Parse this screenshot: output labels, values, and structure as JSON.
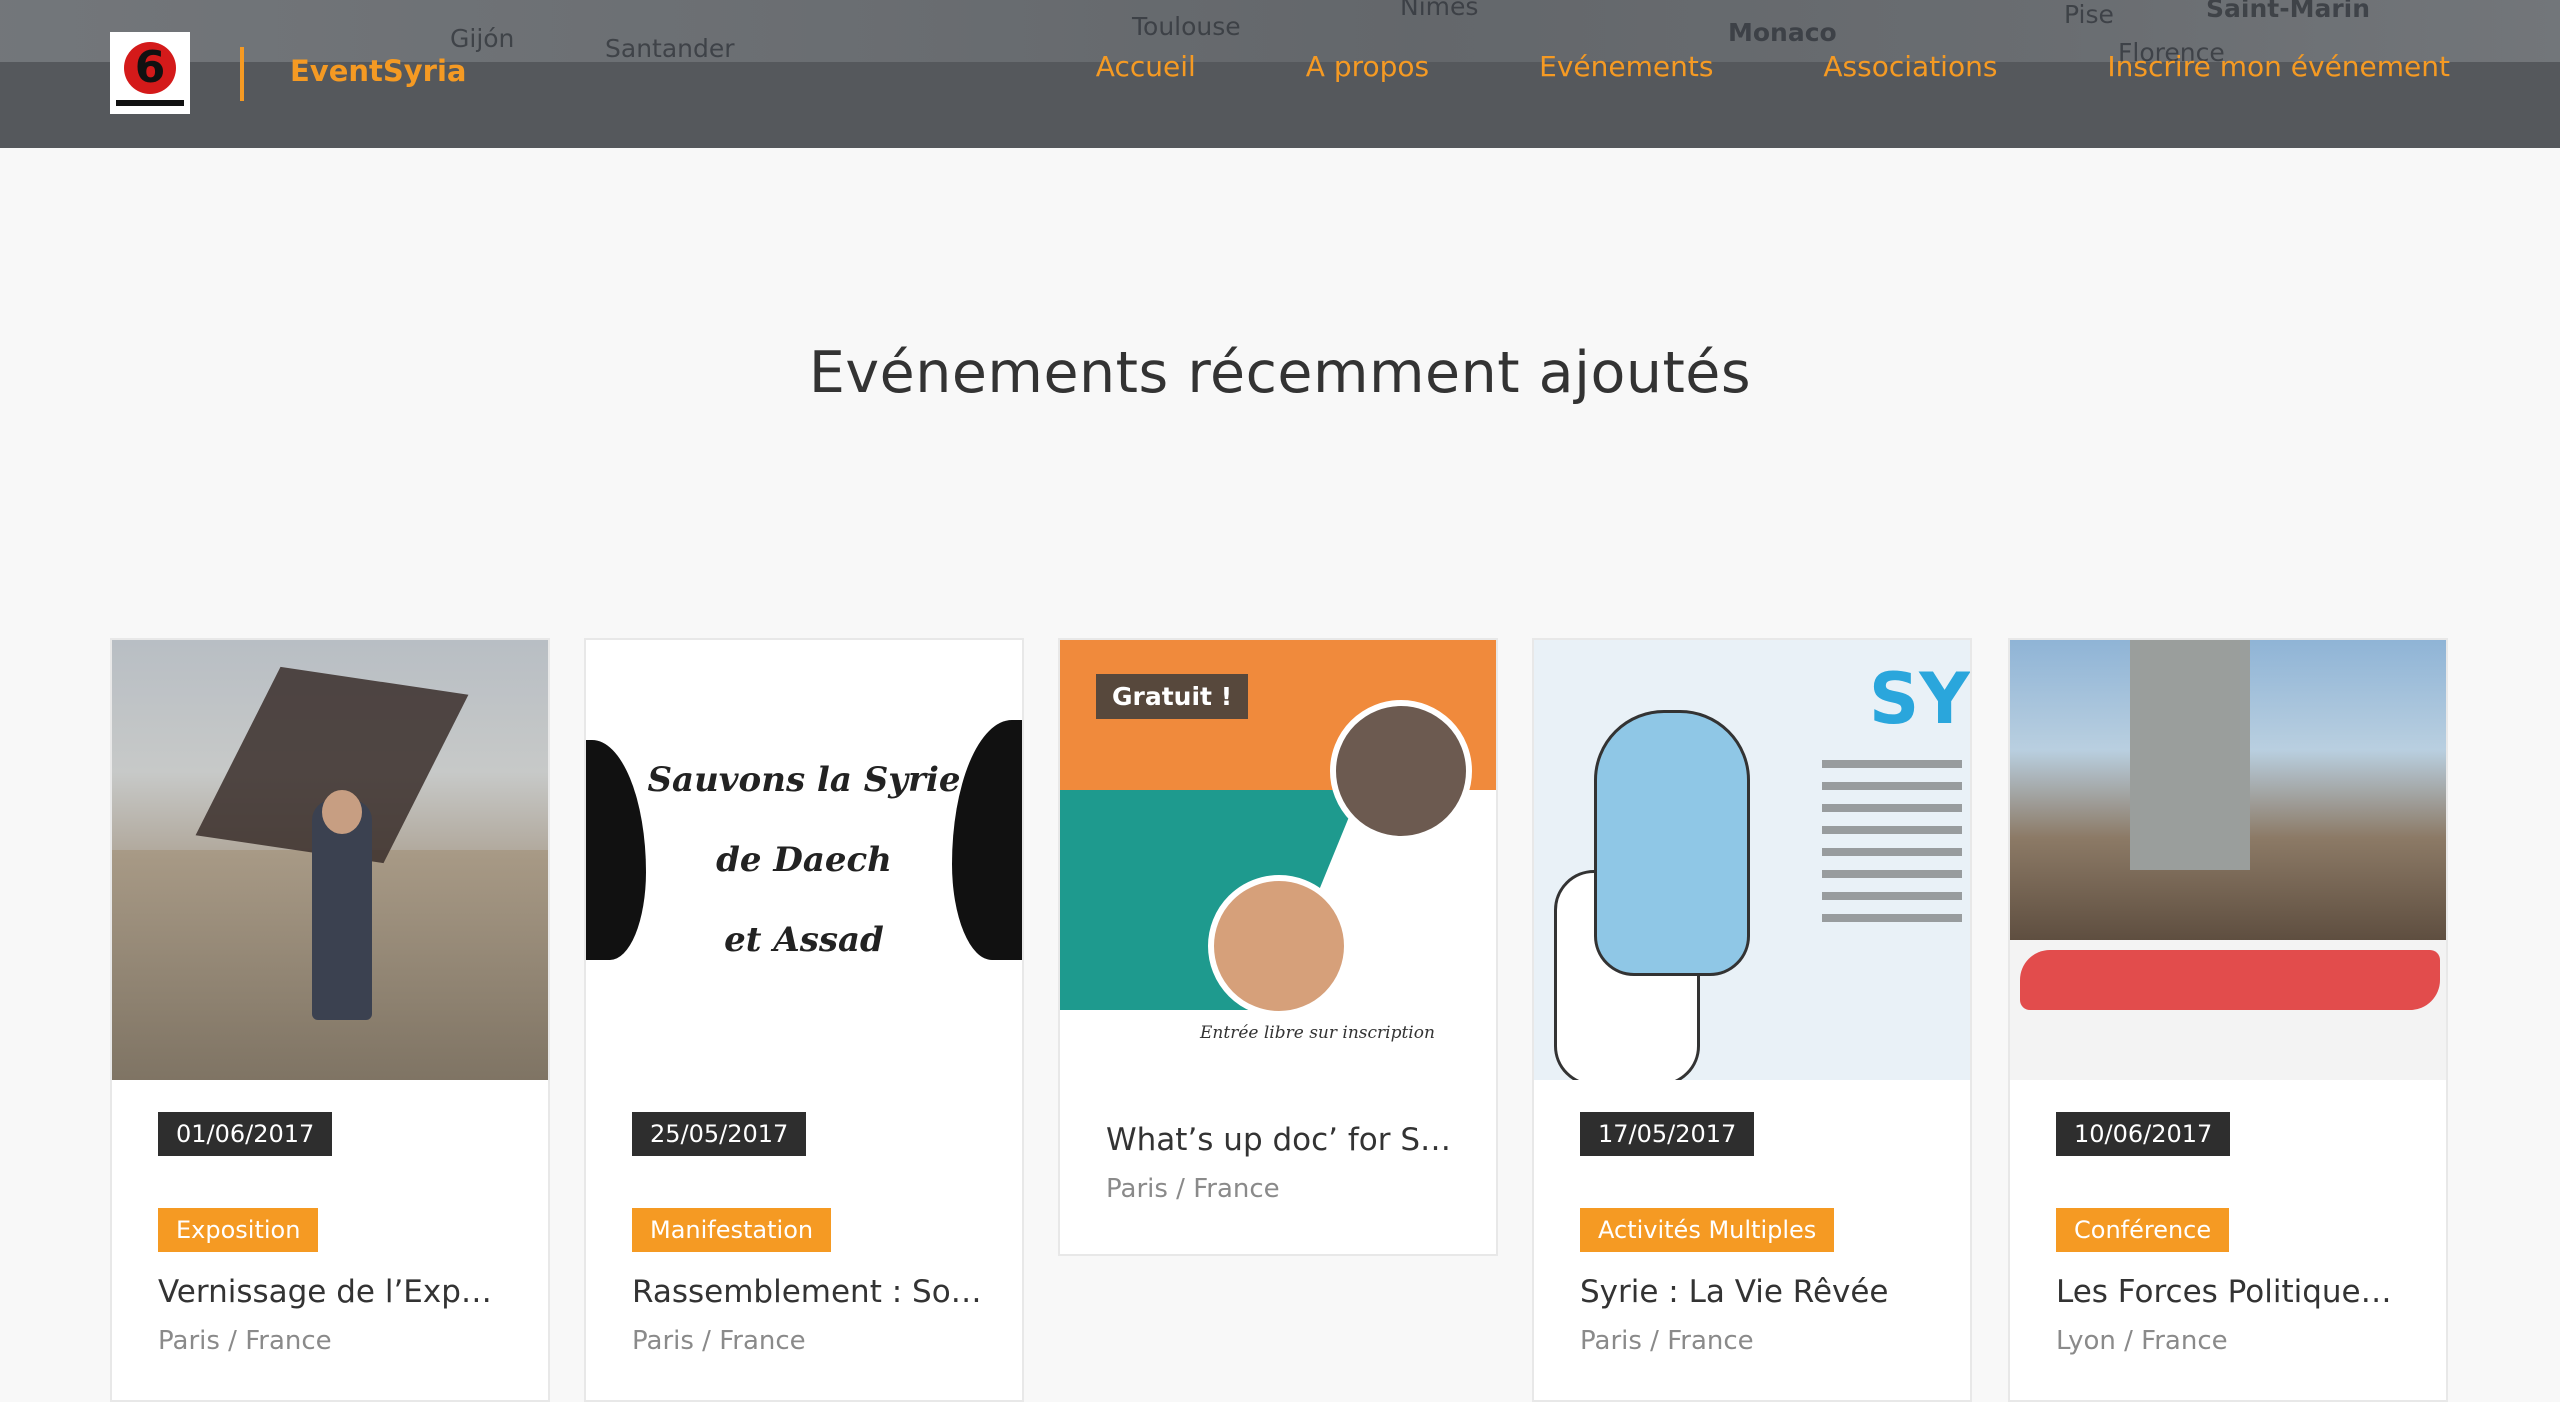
{
  "header": {
    "brand": "EventSyria",
    "logo_alt": "La Révolution Syrienne",
    "map_labels": [
      "Gijón",
      "Santander",
      "Toulouse",
      "Nîmes",
      "Monaco",
      "Pise",
      "Florence",
      "Saint-Marin"
    ],
    "nav": [
      "Accueil",
      "A propos",
      "Evénements",
      "Associations",
      "Inscrire mon événement"
    ]
  },
  "section": {
    "title": "Evénements récemment ajoutés"
  },
  "cards": [
    {
      "date": "01/06/2017",
      "category": "Exposition",
      "title": "Vernissage de l’Exposi…",
      "location": "Paris / France"
    },
    {
      "date": "25/05/2017",
      "category": "Manifestation",
      "title": "Rassemblement : Soli…",
      "location": "Paris / France",
      "poster_lines": [
        "Sauvons la Syrie",
        "de Daech",
        "et Assad"
      ]
    },
    {
      "badge": "Gratuit !",
      "title": "What’s up doc’ for Syr…",
      "location": "Paris / France",
      "flyer_note": "Entrée libre sur inscription"
    },
    {
      "date": "17/05/2017",
      "category": "Activités Multiples",
      "title": "Syrie : La Vie Rêvée",
      "location": "Paris / France"
    },
    {
      "date": "10/06/2017",
      "category": "Conférence",
      "title": "Les Forces Politiques …",
      "location": "Lyon / France"
    }
  ],
  "colors": {
    "accent": "#f59a23",
    "header_bg": "#55585c",
    "date_bg": "#2e2e2e",
    "page_bg": "#f8f8f8"
  }
}
